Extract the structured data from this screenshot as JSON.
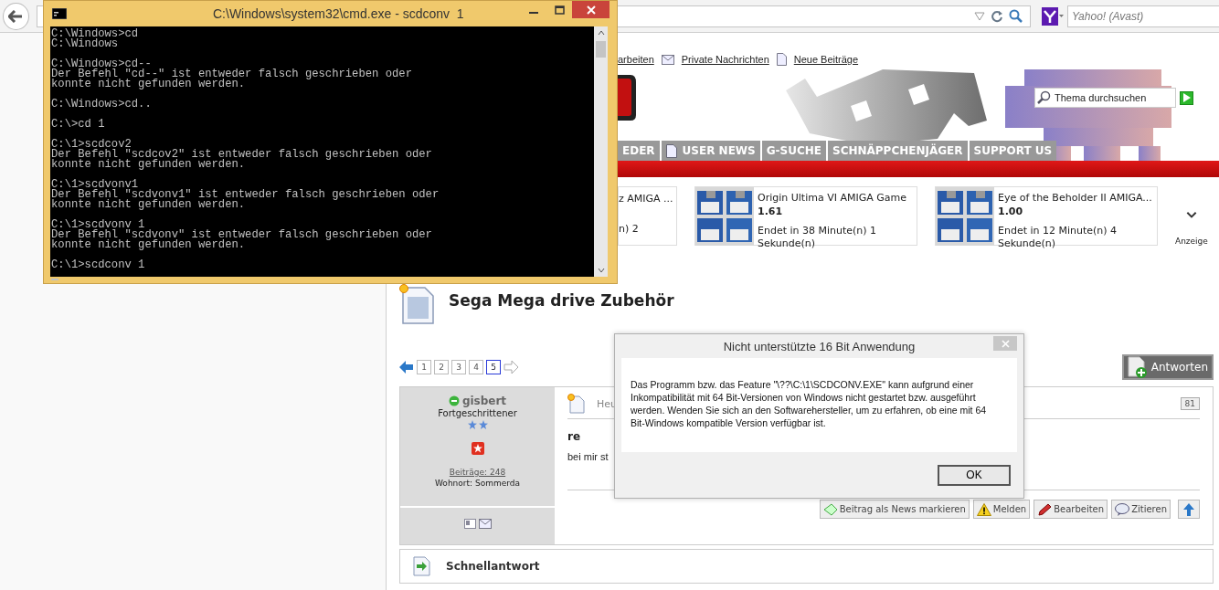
{
  "browser": {
    "search_placeholder": "Yahoo! (Avast)"
  },
  "page": {
    "top_links": [
      {
        "label": "arbeiten"
      },
      {
        "label": "Private Nachrichten"
      },
      {
        "label": "Neue Beiträge"
      }
    ],
    "search_placeholder": "Thema durchsuchen",
    "nav": [
      {
        "label": "EDER"
      },
      {
        "label": "USER NEWS"
      },
      {
        "label": "G-SUCHE"
      },
      {
        "label": "SCHNÄPPCHENJÄGER"
      },
      {
        "label": "SUPPORT US"
      }
    ],
    "ads": [
      {
        "kind": "partial",
        "title": "z AMIGA ...",
        "ends": "n) 2"
      },
      {
        "kind": "full",
        "title": "Origin Ultima VI AMIGA Game",
        "price": "1.61",
        "ends": "Endet in 38 Minute(n) 1 Sekunde(n)"
      },
      {
        "kind": "full",
        "title": "Eye of the Beholder II AMIGA...",
        "price": "1.00",
        "ends": "Endet in 12 Minute(n) 4 Sekunde(n)"
      }
    ],
    "ad_label": "Anzeige",
    "thread": {
      "title": "Sega Mega drive Zubehör",
      "reply_button": "Antworten",
      "pages": [
        {
          "label": "1",
          "selected": false
        },
        {
          "label": "2",
          "selected": false
        },
        {
          "label": "3",
          "selected": false
        },
        {
          "label": "4",
          "selected": false
        },
        {
          "label": "5",
          "selected": true
        }
      ]
    },
    "post": {
      "author": "gisbert",
      "online": true,
      "rank": "Fortgeschrittener",
      "posts": "Beiträge: 248",
      "location": "Wohnort: Sommerda",
      "header": "Heu",
      "number": "81",
      "subject": "re",
      "body": "bei mir st",
      "actions": [
        {
          "label": "Beitrag als News markieren"
        },
        {
          "label": "Melden"
        },
        {
          "label": "Bearbeiten"
        },
        {
          "label": "Zitieren"
        }
      ]
    },
    "quick_reply": "Schnellantwort"
  },
  "cmd_window": {
    "title": "C:\\Windows\\system32\\cmd.exe - scdconv  1",
    "blocks": [
      [
        "C:\\Windows>cd",
        "C:\\Windows"
      ],
      [
        "C:\\Windows>cd--",
        "Der Befehl \"cd--\" ist entweder falsch geschrieben oder",
        "konnte nicht gefunden werden."
      ],
      [
        "C:\\Windows>cd.."
      ],
      [
        "C:\\>cd 1"
      ],
      [
        "C:\\1>scdcov2",
        "Der Befehl \"scdcov2\" ist entweder falsch geschrieben oder",
        "konnte nicht gefunden werden."
      ],
      [
        "C:\\1>scdvonv1",
        "Der Befehl \"scdvonv1\" ist entweder falsch geschrieben oder",
        "konnte nicht gefunden werden."
      ],
      [
        "C:\\1>scdvonv 1",
        "Der Befehl \"scdvonv\" ist entweder falsch geschrieben oder",
        "konnte nicht gefunden werden."
      ],
      [
        "C:\\1>scdconv 1"
      ]
    ]
  },
  "dialog": {
    "title": "Nicht unterstützte 16 Bit Anwendung",
    "message": "Das Programm bzw. das Feature \"\\??\\C:\\1\\SCDCONV.EXE\" kann aufgrund einer Inkompatibilität mit 64 Bit-Versionen von Windows nicht gestartet bzw. ausgeführt werden. Wenden Sie sich an den Softwarehersteller, um zu erfahren, ob eine mit 64 Bit-Windows kompatible Version verfügbar ist.",
    "ok": "OK"
  }
}
